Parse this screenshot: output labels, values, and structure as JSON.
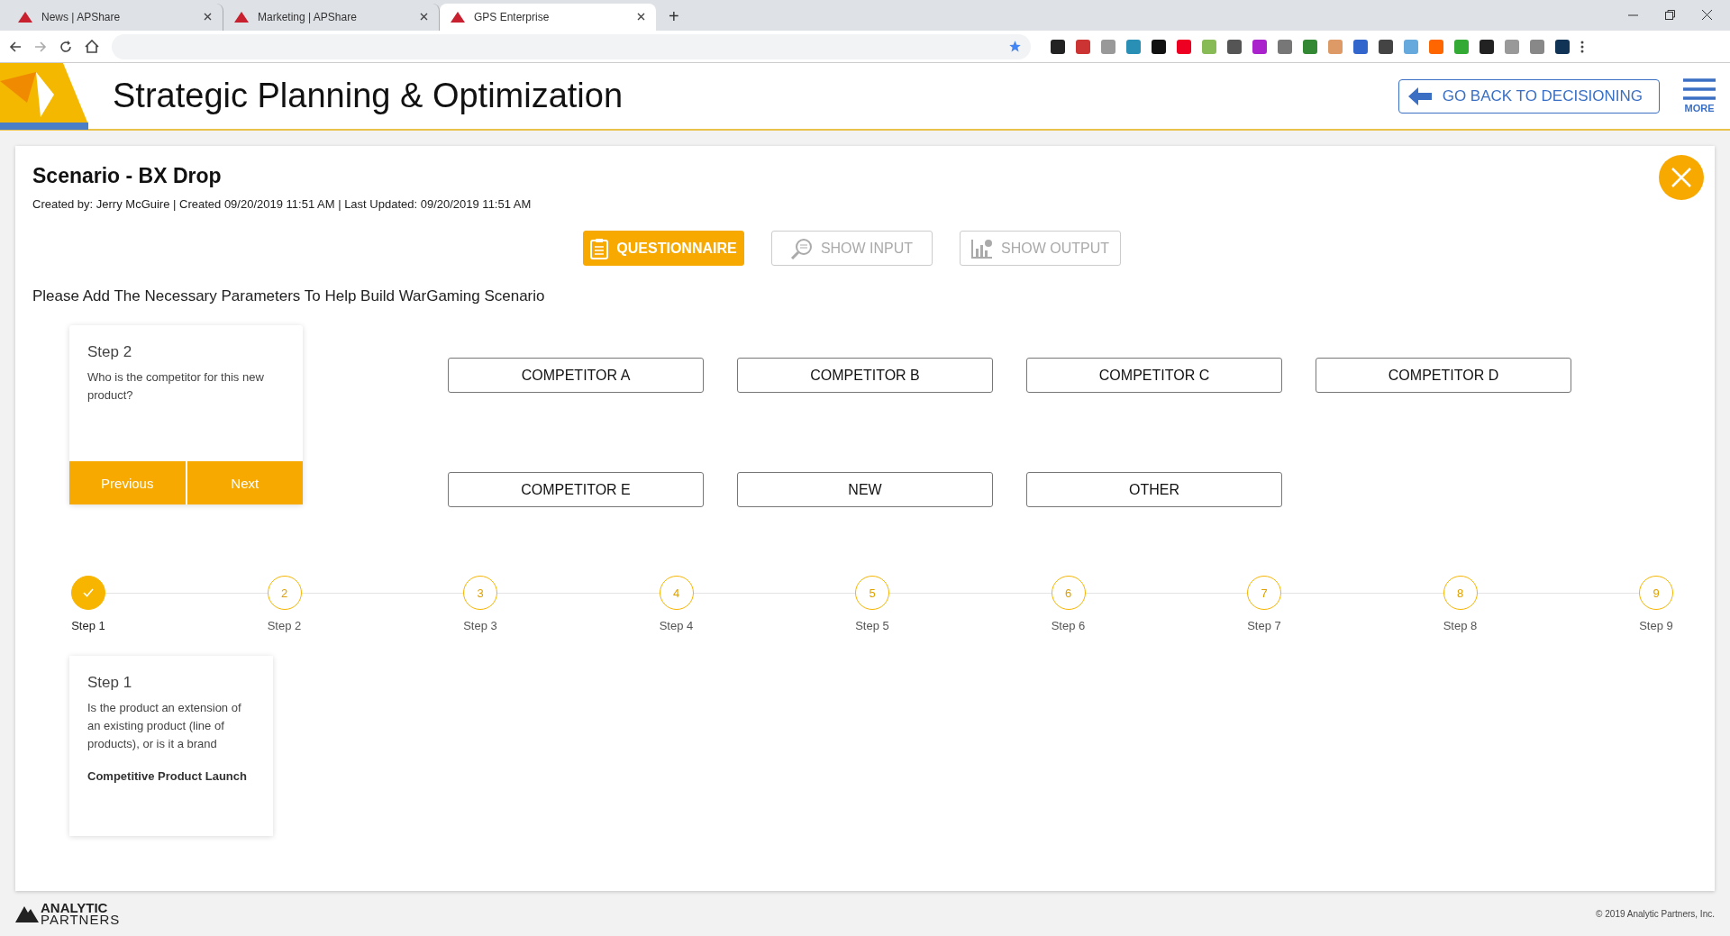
{
  "browser": {
    "tabs": [
      {
        "title": "News | APShare",
        "selected": false
      },
      {
        "title": "Marketing | APShare",
        "selected": false
      },
      {
        "title": "GPS Enterprise",
        "selected": true
      }
    ],
    "new_tab": "+"
  },
  "header": {
    "title": "Strategic Planning & Optimization",
    "back_button": "GO BACK TO DECISIONING",
    "menu_label": "MORE"
  },
  "scenario": {
    "title": "Scenario - BX Drop",
    "meta": "Created by: Jerry McGuire | Created 09/20/2019 11:51 AM | Last Updated: 09/20/2019 11:51 AM",
    "modes": [
      {
        "kind": "questionnaire",
        "label": "QUESTIONNAIRE",
        "selected": true
      },
      {
        "kind": "input",
        "label": "SHOW INPUT",
        "selected": false
      },
      {
        "kind": "output",
        "label": "SHOW OUTPUT",
        "selected": false
      }
    ],
    "instruction": "Please Add The Necessary Parameters To Help Build WarGaming Scenario"
  },
  "current_step": {
    "title": "Step 2",
    "question": "Who is the competitor for this new product?",
    "previous": "Previous",
    "next": "Next"
  },
  "options": [
    "COMPETITOR A",
    "COMPETITOR B",
    "COMPETITOR C",
    "COMPETITOR D",
    "COMPETITOR E",
    "NEW",
    "OTHER"
  ],
  "steps": [
    {
      "label": "Step 1",
      "completed": true
    },
    {
      "number": "2",
      "label": "Step 2",
      "completed": false
    },
    {
      "number": "3",
      "label": "Step 3",
      "completed": false
    },
    {
      "number": "4",
      "label": "Step 4",
      "completed": false
    },
    {
      "number": "5",
      "label": "Step 5",
      "completed": false
    },
    {
      "number": "6",
      "label": "Step 6",
      "completed": false
    },
    {
      "number": "7",
      "label": "Step 7",
      "completed": false
    },
    {
      "number": "8",
      "label": "Step 8",
      "completed": false
    },
    {
      "number": "9",
      "label": "Step 9",
      "completed": false
    }
  ],
  "answered": [
    {
      "title": "Step 1",
      "question": "Is the product an extension of an existing product (line of products), or is it a brand",
      "answer": "Competitive Product Launch"
    }
  ],
  "footer": {
    "logo_top": "ANALYTIC",
    "logo_bottom": "PARTNERS",
    "copyright": "© 2019 Analytic Partners, Inc."
  }
}
